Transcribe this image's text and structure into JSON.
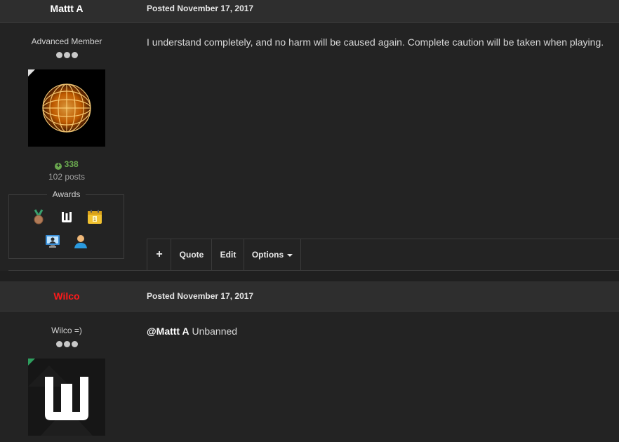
{
  "posts": [
    {
      "author": "Mattt A",
      "author_color": "#ffffff",
      "posted_label": "Posted",
      "posted_date": "November 17, 2017",
      "member_title": "Advanced Member",
      "content": "I understand completely, and no harm will be caused again. Complete caution will be taken when playing.",
      "reputation": "338",
      "posts_count": "102 posts",
      "awards_label": "Awards",
      "avatar_corner_color": "#e0e0e0",
      "actions": {
        "add_label": "+",
        "quote_label": "Quote",
        "edit_label": "Edit",
        "options_label": "Options"
      }
    },
    {
      "author": "Wilco",
      "author_color": "#ff1a1a",
      "posted_label": "Posted",
      "posted_date": "November 17, 2017",
      "member_title": "Wilco =)",
      "mention": "@Mattt A",
      "content": " Unbanned",
      "avatar_corner_color": "#2e9e5e"
    }
  ]
}
